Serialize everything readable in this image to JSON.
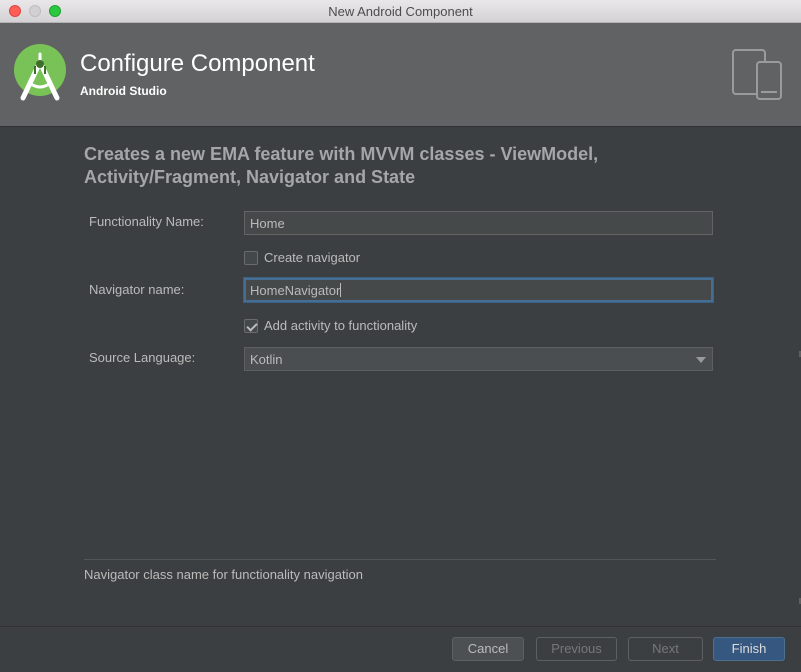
{
  "window": {
    "title": "New Android Component"
  },
  "header": {
    "title": "Configure Component",
    "subtitle": "Android Studio",
    "logo_icon": "android-studio-logo-icon",
    "device_icon": "tablet-phone-icon"
  },
  "description": "Creates a new EMA feature with MVVM classes - ViewModel, Activity/Fragment, Navigator and State",
  "form": {
    "functionality_name": {
      "label": "Functionality Name:",
      "value": "Home"
    },
    "create_navigator": {
      "label": "Create navigator",
      "checked": false
    },
    "navigator_name": {
      "label": "Navigator name:",
      "value": "HomeNavigator"
    },
    "add_activity": {
      "label": "Add activity to functionality",
      "checked": true
    },
    "source_language": {
      "label": "Source Language:",
      "value": "Kotlin"
    }
  },
  "hint": "Navigator class name for functionality navigation",
  "buttons": {
    "cancel": "Cancel",
    "previous": "Previous",
    "next": "Next",
    "finish": "Finish"
  },
  "colors": {
    "background": "#3c3f41",
    "header": "#616263",
    "accent": "#365880",
    "android_green": "#78c257"
  }
}
